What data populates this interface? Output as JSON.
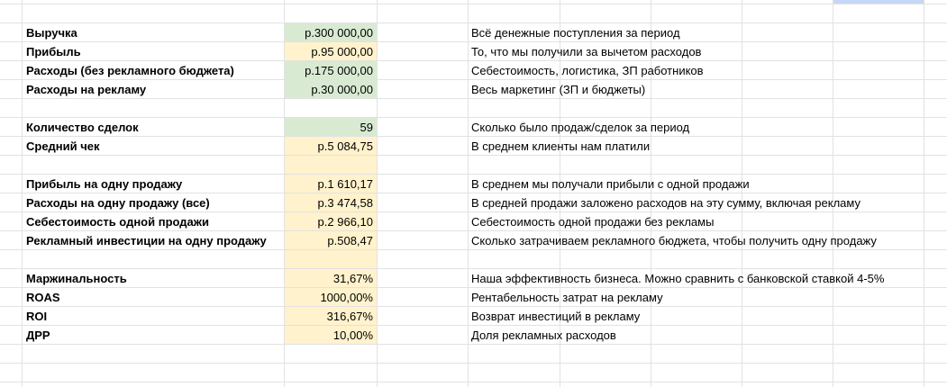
{
  "colors": {
    "green_fill": "#d9ead3",
    "yellow_fill": "#fff2cc",
    "gridline": "#e2e2e2",
    "selection": "#c6d8f6"
  },
  "rows": [
    {
      "label": "Выручка",
      "value": "р.300 000,00",
      "fill": "green",
      "description": "Всё денежные поступления за период"
    },
    {
      "label": "Прибыль",
      "value": "р.95 000,00",
      "fill": "yellow",
      "description": "То, что мы получили за вычетом расходов"
    },
    {
      "label": "Расходы (без рекламного бюджета)",
      "value": "р.175 000,00",
      "fill": "green",
      "description": "Себестоимость, логистика, ЗП работников"
    },
    {
      "label": "Расходы на рекламу",
      "value": "р.30 000,00",
      "fill": "green",
      "description": "Весь маркетинг (ЗП и бюджеты)"
    },
    {
      "label": "Количество сделок",
      "value": "59",
      "fill": "green",
      "description": "Сколько было продаж/сделок за период"
    },
    {
      "label": "Средний чек",
      "value": "р.5 084,75",
      "fill": "yellow",
      "description": "В среднем клиенты нам платили"
    },
    {
      "label": "Прибыль на одну продажу",
      "value": "р.1 610,17",
      "fill": "yellow",
      "description": "В среднем мы получали прибыли с одной продажи"
    },
    {
      "label": "Расходы на одну продажу (все)",
      "value": "р.3 474,58",
      "fill": "yellow",
      "description": "В средней продажи заложено расходов на эту сумму, включая рекламу"
    },
    {
      "label": "Себестоимость одной продажи",
      "value": "р.2 966,10",
      "fill": "yellow",
      "description": "Себестоимость одной продажи без рекламы"
    },
    {
      "label": "Рекламный инвестиции на одну продажу",
      "value": "р.508,47",
      "fill": "yellow",
      "description": "Сколько затрачиваем рекламного бюджета, чтобы получить одну продажу"
    },
    {
      "label": "Маржинальность",
      "value": "31,67%",
      "fill": "yellow",
      "description": "Наша эффективность бизнеса. Можно сравнить с банковской ставкой 4-5%"
    },
    {
      "label": "ROAS",
      "value": "1000,00%",
      "fill": "yellow",
      "description": "Рентабельность затрат на рекламу"
    },
    {
      "label": "ROI",
      "value": "316,67%",
      "fill": "yellow",
      "description": "Возврат инвестиций в рекламу"
    },
    {
      "label": "ДРР",
      "value": "10,00%",
      "fill": "yellow",
      "description": "Доля рекламных расходов"
    }
  ]
}
